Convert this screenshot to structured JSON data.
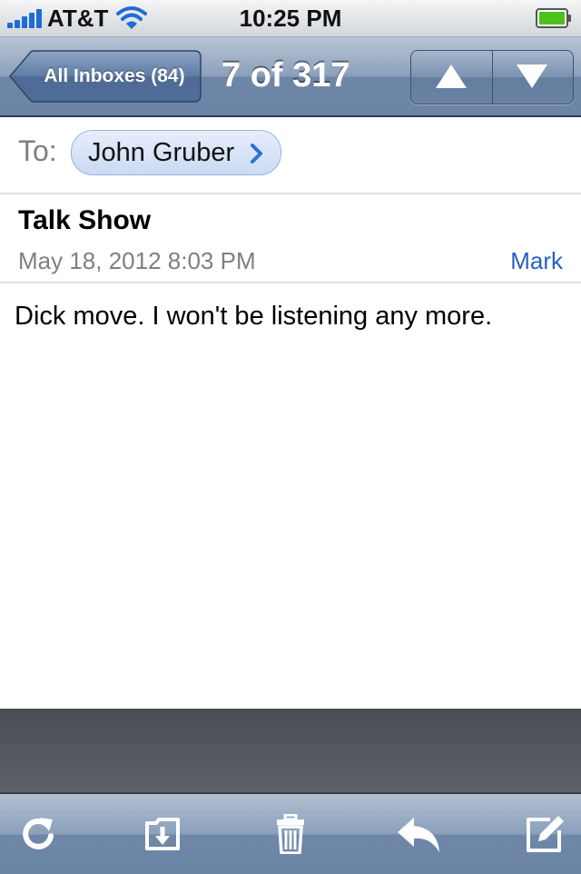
{
  "status_bar": {
    "carrier": "AT&T",
    "time": "10:25 PM",
    "signal_icon": "signal-bars-icon",
    "wifi_icon": "wifi-icon",
    "battery_icon": "battery-icon"
  },
  "nav": {
    "back_label": "All Inboxes (84)",
    "title": "7 of 317",
    "prev_icon": "arrow-up-icon",
    "next_icon": "arrow-down-icon"
  },
  "header": {
    "to_label": "To:",
    "recipient": "John Gruber",
    "subject": "Talk Show",
    "date": "May 18, 2012 8:03 PM",
    "mark_label": "Mark"
  },
  "message": {
    "body": "Dick move. I won't be listening any more."
  },
  "toolbar": {
    "items": [
      "refresh-icon",
      "move-to-folder-icon",
      "trash-icon",
      "reply-icon",
      "compose-icon"
    ]
  },
  "colors": {
    "nav_blue": "#6c84a5",
    "link_blue": "#2a5fc4",
    "signal_blue": "#1f6bd8",
    "battery_green": "#4cc21c"
  }
}
